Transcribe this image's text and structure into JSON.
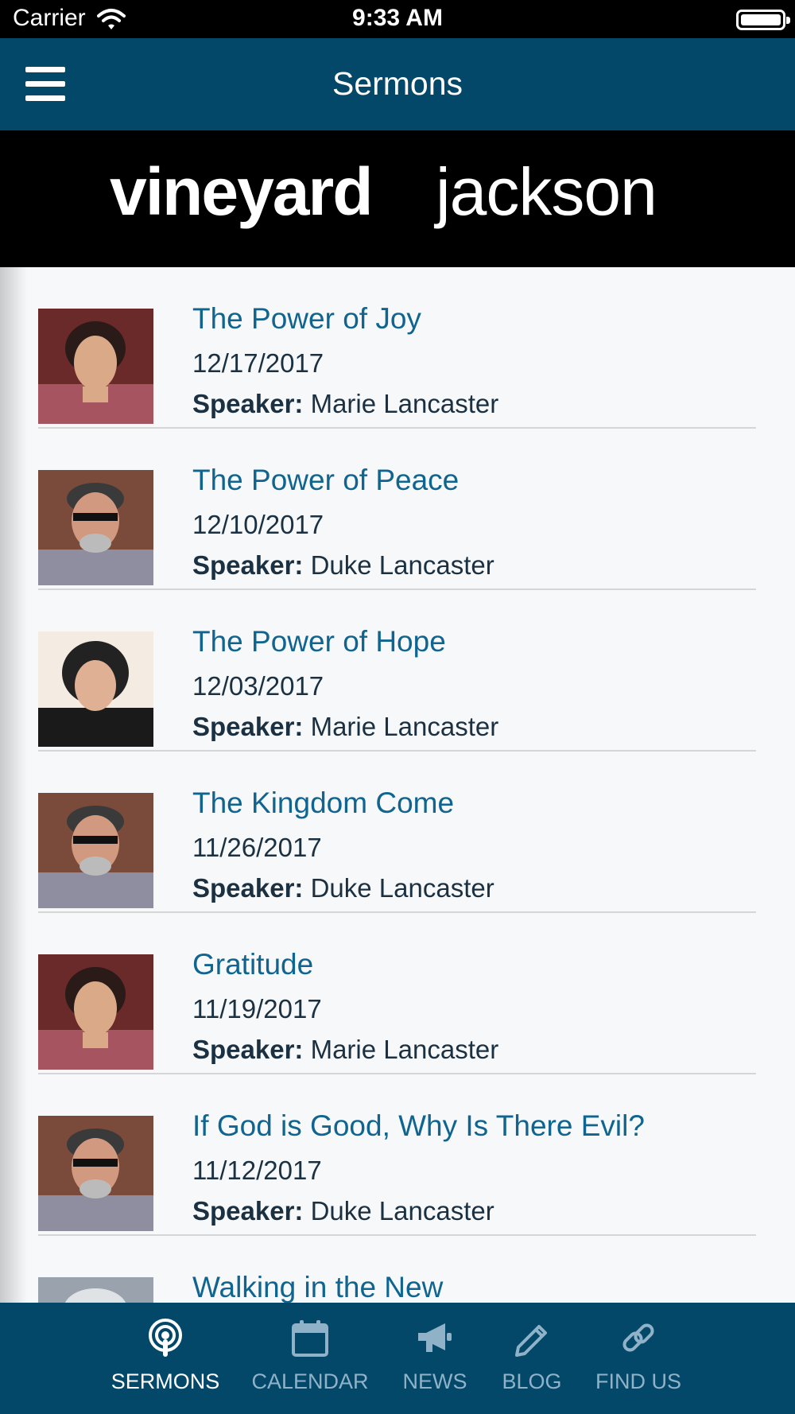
{
  "status_bar": {
    "carrier": "Carrier",
    "time": "9:33 AM"
  },
  "nav": {
    "title": "Sermons"
  },
  "logo": {
    "text": "vineyardjackson"
  },
  "speaker_label": "Speaker:",
  "sermons": [
    {
      "title": "The Power of Joy",
      "date": "12/17/2017",
      "speaker": "Marie Lancaster"
    },
    {
      "title": "The Power of Peace",
      "date": "12/10/2017",
      "speaker": "Duke Lancaster"
    },
    {
      "title": "The Power of Hope",
      "date": "12/03/2017",
      "speaker": "Marie Lancaster"
    },
    {
      "title": "The Kingdom Come",
      "date": "11/26/2017",
      "speaker": "Duke Lancaster"
    },
    {
      "title": "Gratitude",
      "date": "11/19/2017",
      "speaker": "Marie Lancaster"
    },
    {
      "title": "If God is Good, Why Is There Evil?",
      "date": "11/12/2017",
      "speaker": "Duke Lancaster"
    },
    {
      "title": "Walking in the New",
      "date": "",
      "speaker": ""
    }
  ],
  "tabs": [
    {
      "label": "SERMONS",
      "icon": "podcast-icon",
      "active": true
    },
    {
      "label": "CALENDAR",
      "icon": "calendar-icon",
      "active": false
    },
    {
      "label": "NEWS",
      "icon": "megaphone-icon",
      "active": false
    },
    {
      "label": "BLOG",
      "icon": "pencil-icon",
      "active": false
    },
    {
      "label": "FIND US",
      "icon": "link-icon",
      "active": false
    }
  ],
  "colors": {
    "nav_background": "#044869",
    "title_blue": "#0f6490",
    "text_dark": "#1b3142",
    "tab_inactive": "#8fb2c8",
    "tab_active": "#ffffff"
  }
}
